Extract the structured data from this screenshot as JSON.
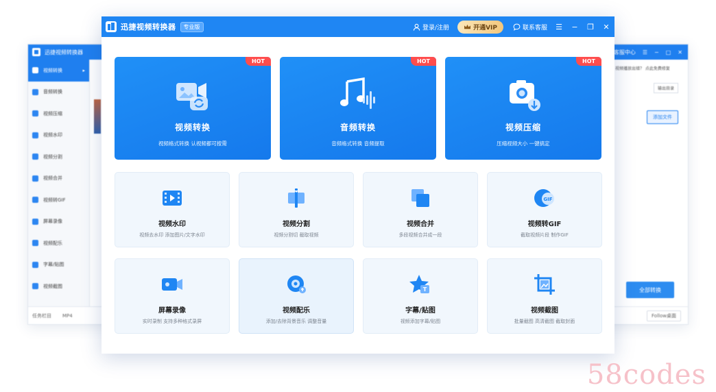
{
  "background_window": {
    "title": "迅捷视频转换器",
    "header_links": [
      "客服中心"
    ],
    "sidebar": [
      {
        "label": "视频转换",
        "active": true
      },
      {
        "label": "音频转换",
        "active": false
      },
      {
        "label": "视频压缩",
        "active": false
      },
      {
        "label": "视频水印",
        "active": false
      },
      {
        "label": "视频分割",
        "active": false
      },
      {
        "label": "视频合并",
        "active": false
      },
      {
        "label": "视频转GIF",
        "active": false
      },
      {
        "label": "屏幕录像",
        "active": false
      },
      {
        "label": "视频配乐",
        "active": false
      },
      {
        "label": "字幕/贴图",
        "active": false
      },
      {
        "label": "视频截图",
        "active": false
      }
    ],
    "bottom_label": "任务栏目",
    "bottom_value": "MP4",
    "bottom_select": "Follow桌面",
    "top_hint": "视频播放出错？ 点此免费修复",
    "output_btn": "输出目录",
    "add_btn": "添加文件",
    "convert_all_btn": "全部转换"
  },
  "titlebar": {
    "app_name": "迅捷视频转换器",
    "version_badge": "专业版",
    "login_label": "登录/注册",
    "vip_label": "开通VIP",
    "support_label": "联系客服"
  },
  "big_cards": [
    {
      "title": "视频转换",
      "subtitle": "视频格式转换 认视频都可按需",
      "badge": "HOT",
      "icon": "video-convert-icon"
    },
    {
      "title": "音频转换",
      "subtitle": "音频格式转换 音频提取",
      "badge": "HOT",
      "icon": "audio-convert-icon"
    },
    {
      "title": "视频压缩",
      "subtitle": "压缩视频大小 一键搞定",
      "badge": "HOT",
      "icon": "video-compress-icon"
    }
  ],
  "small_cards": [
    {
      "title": "视频水印",
      "subtitle": "视频去水印 添加图片/文字水印",
      "icon": "watermark-icon"
    },
    {
      "title": "视频分割",
      "subtitle": "视频分割切 截取视频",
      "icon": "split-icon"
    },
    {
      "title": "视频合并",
      "subtitle": "多段视频合并成一段",
      "icon": "merge-icon"
    },
    {
      "title": "视频转GIF",
      "subtitle": "截取视频片段 制作GIF",
      "icon": "gif-icon"
    },
    {
      "title": "屏幕录像",
      "subtitle": "实时录制 支持多种格式录屏",
      "icon": "screen-record-icon"
    },
    {
      "title": "视频配乐",
      "subtitle": "添加/去除背景音乐 调整音量",
      "icon": "music-icon"
    },
    {
      "title": "字幕/贴图",
      "subtitle": "视频添加字幕/贴图",
      "icon": "subtitle-icon"
    },
    {
      "title": "视频截图",
      "subtitle": "批量截图 高清截图 截取封面",
      "icon": "screenshot-icon"
    }
  ],
  "watermark_text": "58codes",
  "colors": {
    "primary": "#1f86f3",
    "hot": "#ff4d4d",
    "vip_gold": "#f2c77d"
  }
}
